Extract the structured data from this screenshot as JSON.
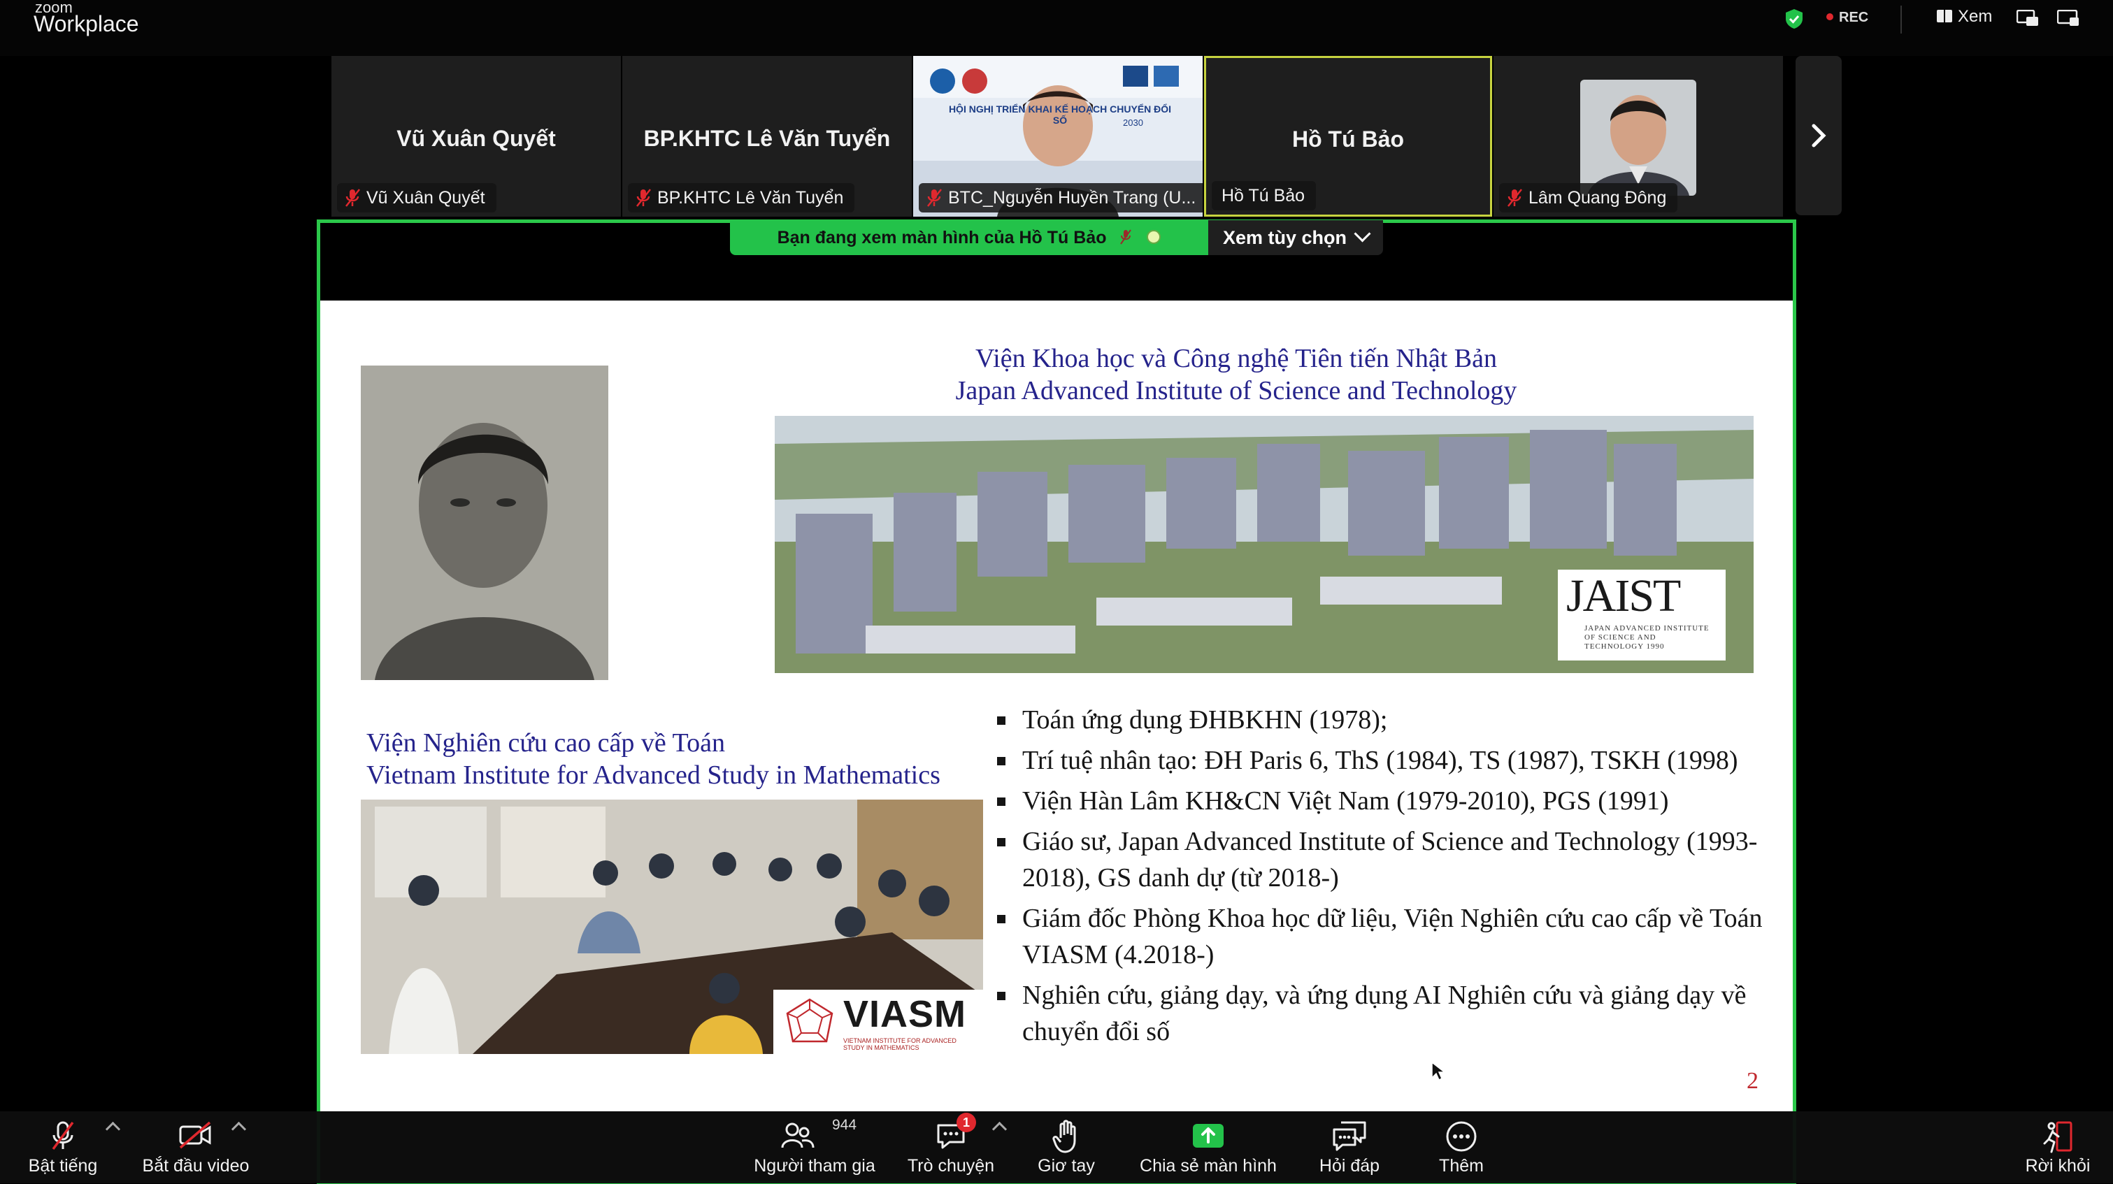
{
  "app": {
    "logo_small": "zoom",
    "logo_big": "Workplace"
  },
  "topbar": {
    "rec_label": "REC",
    "view_label": "Xem"
  },
  "participants": [
    {
      "big_name": "Vũ Xuân Quyết",
      "label": "Vũ Xuân Quyết"
    },
    {
      "big_name": "BP.KHTC Lê Văn Tuyển",
      "label": "BP.KHTC Lê Văn Tuyển"
    },
    {
      "label": "BTC_Nguyễn Huyền Trang (U...",
      "banner_text": "HỘI NGHỊ TRIỂN KHAI KẾ HOẠCH CHUYỂN ĐỔI SỐ",
      "banner_year": "2030"
    },
    {
      "big_name": "Hồ Tú Bảo",
      "label": "Hồ Tú Bảo"
    },
    {
      "label": "Lâm Quang Đông"
    }
  ],
  "share_banner": {
    "text": "Bạn đang xem màn hình của  Hồ Tú Bảo",
    "options_label": "Xem tùy chọn"
  },
  "slide": {
    "jaist_title_vi": "Viện Khoa học và Công nghệ Tiên tiến Nhật Bản",
    "jaist_title_en": "Japan Advanced Institute of Science and Technology",
    "jaist_logo": "JAIST",
    "jaist_logo_sub": "JAPAN ADVANCED INSTITUTE OF SCIENCE AND TECHNOLOGY 1990",
    "viasm_title_vi": "Viện Nghiên cứu cao cấp về Toán",
    "viasm_title_en": "Vietnam Institute for Advanced Study in Mathematics",
    "viasm_logo": "VIASM",
    "viasm_logo_sub": "VIETNAM INSTITUTE FOR ADVANCED STUDY IN MATHEMATICS",
    "bullets": [
      "Toán ứng dụng ĐHBKHN (1978);",
      "Trí tuệ nhân tạo: ĐH Paris 6, ThS (1984),  TS (1987), TSKH (1998)",
      "Viện Hàn Lâm KH&CN Việt Nam (1979-2010), PGS (1991)",
      "Giáo sư, Japan Advanced Institute of Science and Technology (1993-2018), GS danh dự (từ 2018-)",
      "Giám đốc Phòng Khoa học dữ liệu, Viện Nghiên cứu cao cấp về Toán  VIASM (4.2018-)",
      "Nghiên cứu, giảng dạy,  và ứng dụng AI Nghiên cứu và giảng dạy về chuyển đổi số"
    ],
    "page_number": "2"
  },
  "toolbar": {
    "unmute": "Bật tiếng",
    "start_video": "Bắt đầu video",
    "participants": "Người tham gia",
    "participants_count": "944",
    "chat": "Trò chuyện",
    "chat_badge": "1",
    "raise_hand": "Giơ tay",
    "share_screen": "Chia sẻ màn hình",
    "qa": "Hỏi đáp",
    "more": "Thêm",
    "leave": "Rời khỏi"
  },
  "colors": {
    "share_green": "#23c24a",
    "active_border": "#c7d33f",
    "slide_title": "#25238b",
    "rec_red": "#e0282e"
  }
}
